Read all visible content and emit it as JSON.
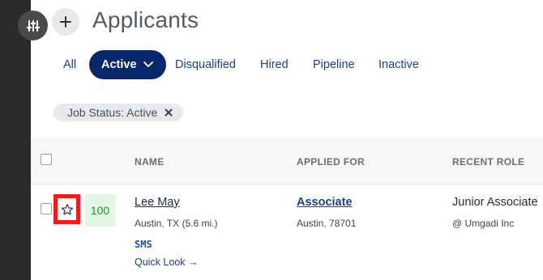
{
  "header": {
    "title": "Applicants",
    "add_icon": "plus-icon",
    "filter_icon": "sliders-icon"
  },
  "tabs": [
    {
      "label": "All",
      "active": false
    },
    {
      "label": "Active",
      "active": true
    },
    {
      "label": "Disqualified",
      "active": false
    },
    {
      "label": "Hired",
      "active": false
    },
    {
      "label": "Pipeline",
      "active": false
    },
    {
      "label": "Inactive",
      "active": false
    }
  ],
  "filters": {
    "chip_label": "Job Status: Active",
    "chip_close_icon": "close-icon"
  },
  "table": {
    "columns": [
      "NAME",
      "APPLIED FOR",
      "RECENT ROLE"
    ],
    "rows": [
      {
        "starred": false,
        "score": "100",
        "name": "Lee May",
        "location": "Austin, TX (5.6 mi.)",
        "sms_label": "SMS",
        "quick_look": "Quick Look →",
        "applied_for": "Associate",
        "applied_location": "Austin, 78701",
        "recent_role": "Junior Associate",
        "company": "@ Umgadi Inc"
      }
    ]
  },
  "colors": {
    "primary": "#06276b",
    "link": "#1d3f8a",
    "score_bg": "#e2f6e3",
    "score_text": "#2f8a35",
    "highlight": "#ee1c1c",
    "rail": "#2b2b2b"
  }
}
